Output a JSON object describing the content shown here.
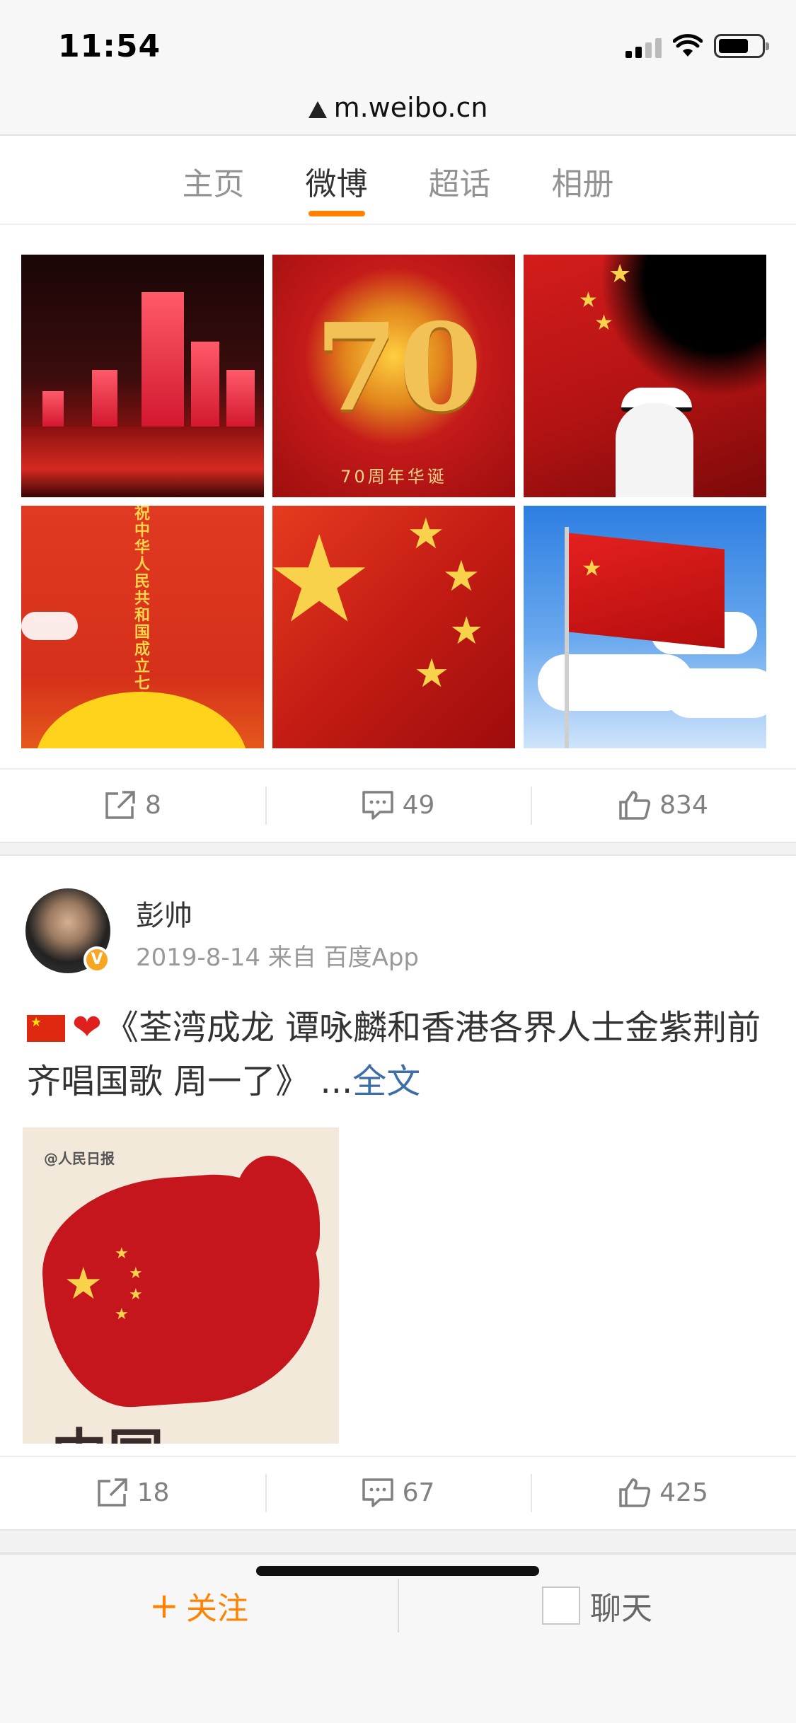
{
  "status_bar": {
    "time": "11:54"
  },
  "url_bar": {
    "host": "m.weibo.cn"
  },
  "tabs": [
    {
      "label": "主页",
      "active": false
    },
    {
      "label": "微博",
      "active": true
    },
    {
      "label": "超话",
      "active": false
    },
    {
      "label": "相册",
      "active": false
    }
  ],
  "post1": {
    "images": [
      {
        "icon": "city-night-image"
      },
      {
        "icon": "seventy-anniversary-image",
        "number": "70",
        "caption": "70周年华诞"
      },
      {
        "icon": "flag-guard-image"
      },
      {
        "icon": "celebration-poster-image",
        "vertical_text": "祝中华人民共和国成立七十周年"
      },
      {
        "icon": "flag-stars-closeup-image"
      },
      {
        "icon": "flag-sky-image"
      }
    ],
    "actions": {
      "repost": "8",
      "comment": "49",
      "like": "834"
    }
  },
  "post2": {
    "author": "彭帅",
    "verified_badge": "V",
    "meta": "2019-8-14 来自 百度App",
    "text": "《荃湾成龙 谭咏麟和香港各界人士金紫荆前齐唱国歌 周一了》 ...",
    "more_link": "全文",
    "image_watermark": "@人民日报",
    "image_text": "中国",
    "actions": {
      "repost": "18",
      "comment": "67",
      "like": "425"
    }
  },
  "bottom_bar": {
    "follow": "关注",
    "chat": "聊天"
  },
  "colors": {
    "accent": "#ff8200",
    "link": "#3d6ea5",
    "muted": "#808080"
  }
}
